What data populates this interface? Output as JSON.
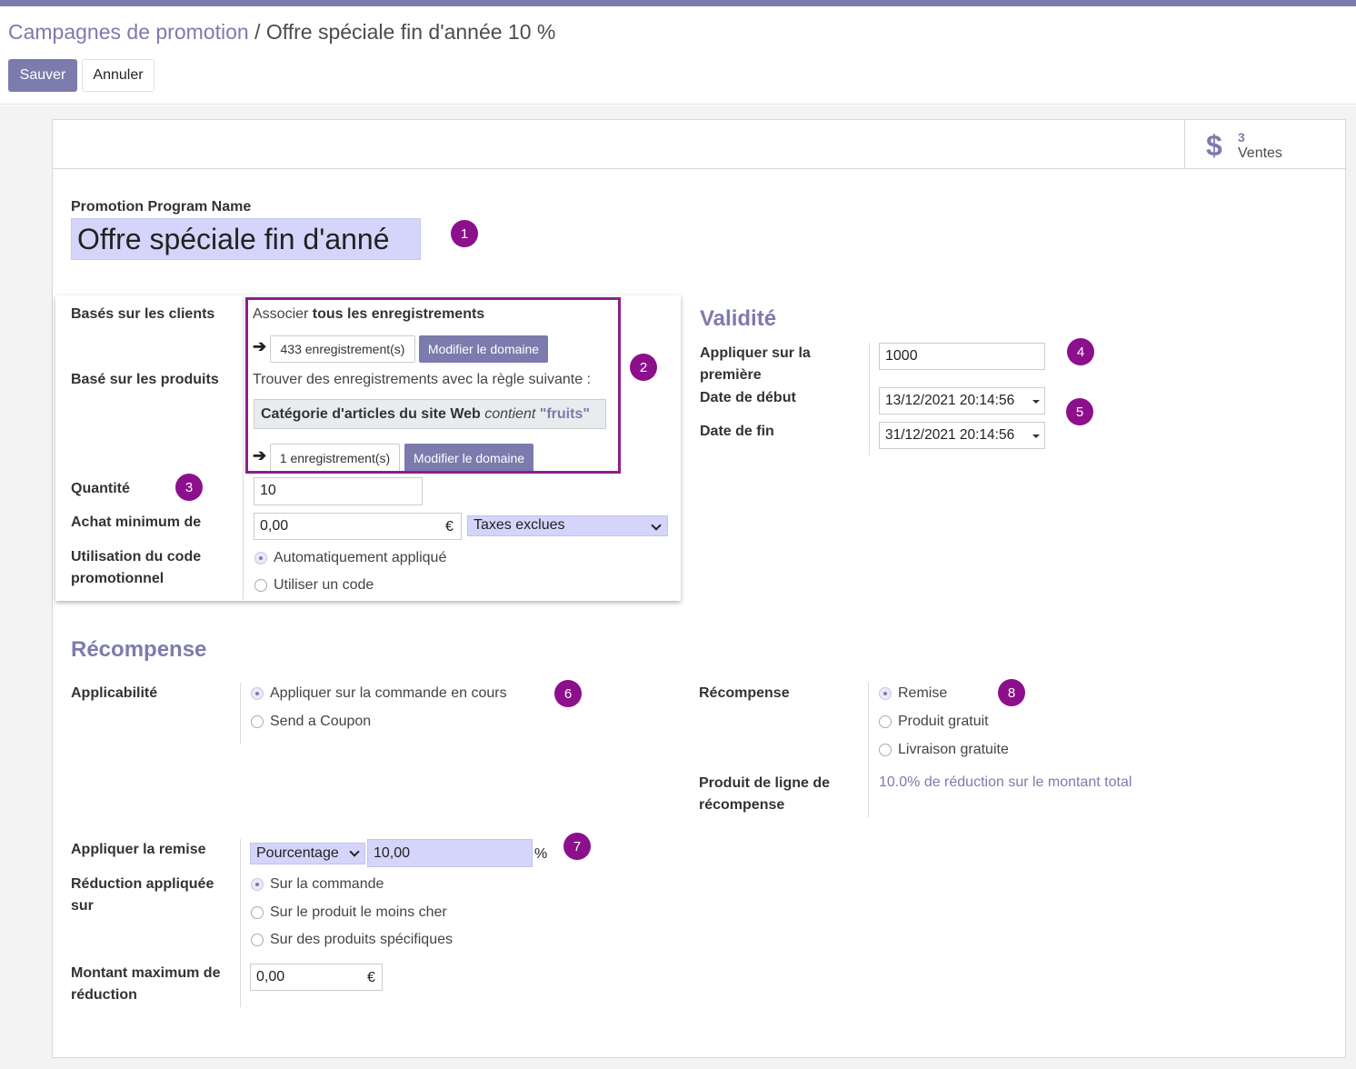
{
  "breadcrumb": {
    "parent": "Campagnes de promotion",
    "separator": "/",
    "current": "Offre spéciale fin d'année 10 %"
  },
  "toolbar": {
    "save_label": "Sauver",
    "cancel_label": "Annuler"
  },
  "stat_button": {
    "value": "3",
    "label": "Ventes",
    "icon": "dollar-icon"
  },
  "program_name": {
    "label": "Promotion Program Name",
    "value": "Offre spéciale fin d'anné"
  },
  "badges": [
    "1",
    "2",
    "3",
    "4",
    "5",
    "6",
    "7",
    "8"
  ],
  "rules": {
    "customers_label": "Basés sur les clients",
    "customers_prefix": "Associer ",
    "customers_match": "tous les enregistrements",
    "customers_count": "433 enregistrement(s)",
    "modify_domain": "Modifier le domaine",
    "products_label": "Basé sur les produits",
    "products_rule_intro": "Trouver des enregistrements avec la règle suivante :",
    "rule_field": "Catégorie d'articles du site Web",
    "rule_operator": "contient",
    "rule_value": "\"fruits\"",
    "products_count": "1 enregistrement(s)",
    "quantity_label": "Quantité",
    "quantity_value": "10",
    "min_purchase_label": "Achat minimum de",
    "min_purchase_value": "0,00",
    "currency": "€",
    "tax_mode": "Taxes exclues",
    "code_usage_label_1": "Utilisation du code",
    "code_usage_label_2": "promotionnel",
    "code_usage_options": [
      "Automatiquement appliqué",
      "Utiliser un code"
    ]
  },
  "validity": {
    "title": "Validité",
    "apply_first_label_1": "Appliquer sur la",
    "apply_first_label_2": "première",
    "apply_first_value": "1000",
    "start_label": "Date de début",
    "start_value": "13/12/2021 20:14:56",
    "end_label": "Date de fin",
    "end_value": "31/12/2021 20:14:56"
  },
  "reward": {
    "title": "Récompense",
    "applicability_label": "Applicabilité",
    "applicability_options": [
      "Appliquer sur la commande en cours",
      "Send a Coupon"
    ],
    "reward_label": "Récompense",
    "reward_options": [
      "Remise",
      "Produit gratuit",
      "Livraison gratuite"
    ],
    "reward_line_label_1": "Produit de ligne de",
    "reward_line_label_2": "récompense",
    "reward_line_value": "10.0% de réduction sur le montant total",
    "apply_discount_label": "Appliquer la remise",
    "discount_type": "Pourcentage",
    "discount_value": "10,00",
    "percent_sign": "%",
    "applied_on_label_1": "Réduction appliquée",
    "applied_on_label_2": "sur",
    "applied_on_options": [
      "Sur la commande",
      "Sur le produit le moins cher",
      "Sur des produits spécifiques"
    ],
    "max_amount_label_1": "Montant maximum de",
    "max_amount_label_2": "réduction",
    "max_amount_value": "0,00",
    "currency": "€"
  }
}
